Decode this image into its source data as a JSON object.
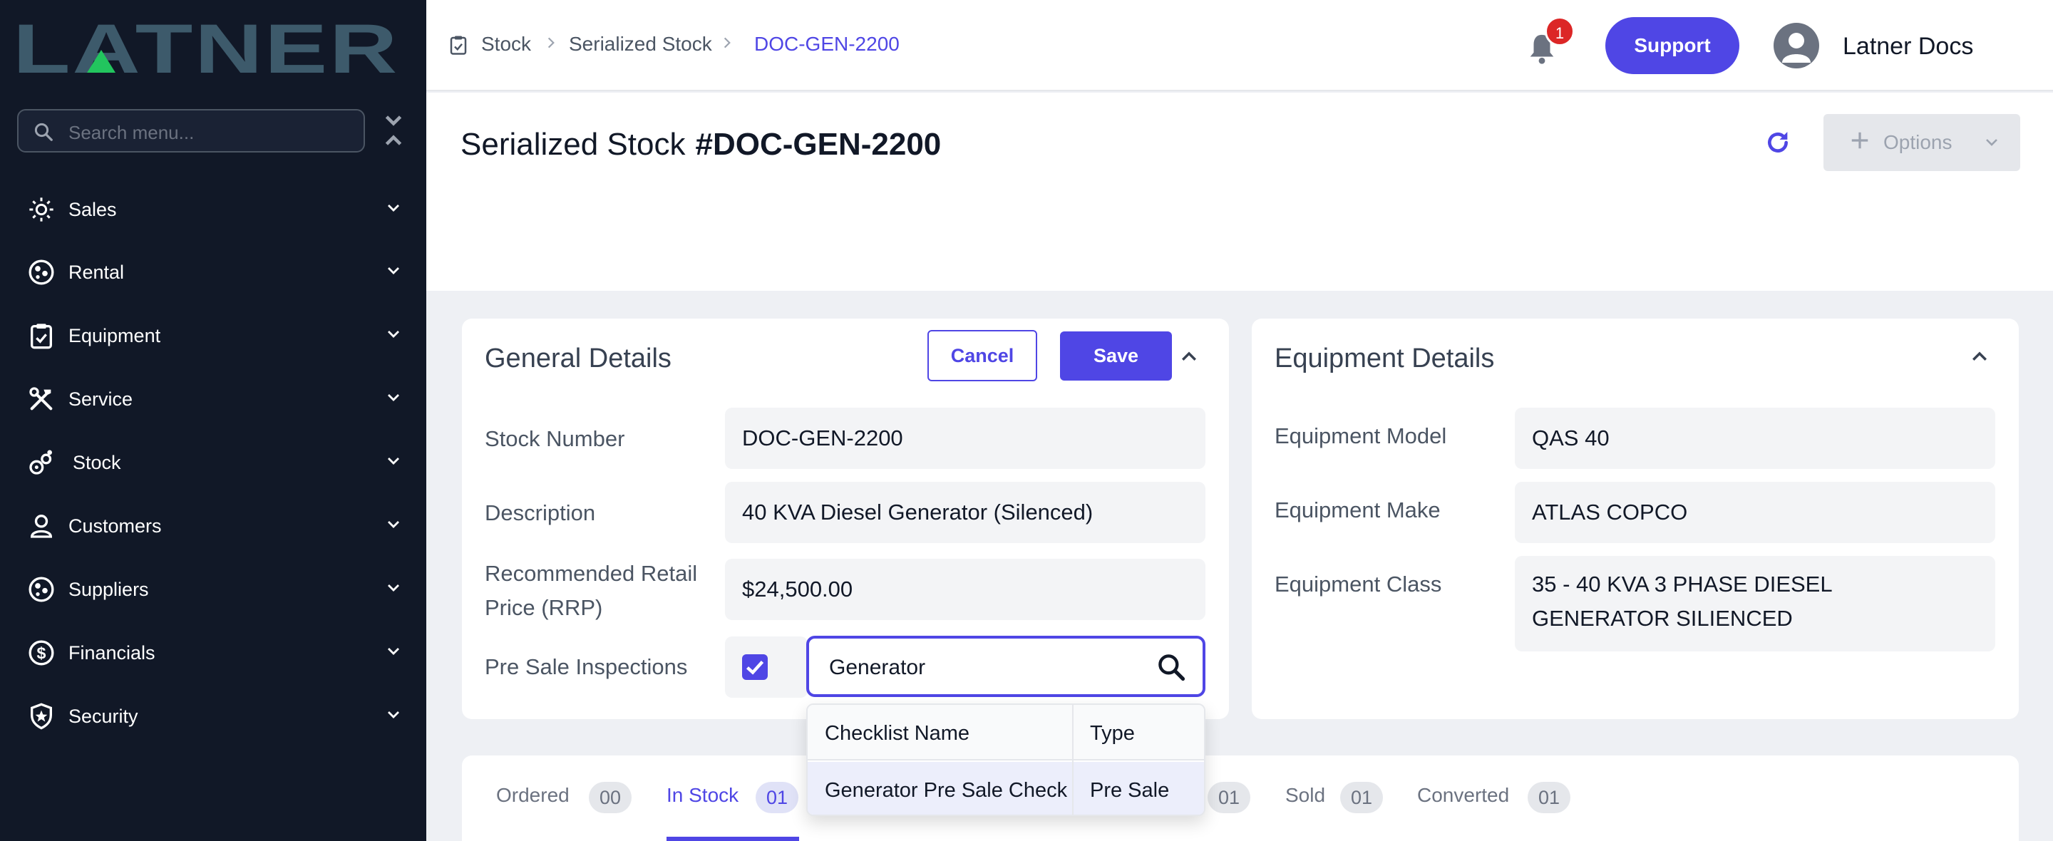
{
  "brand": {
    "logo_text": "LATNER",
    "accent": "#4f46e5",
    "sidebar_bg": "#111827"
  },
  "sidebar": {
    "search_placeholder": "Search menu...",
    "items": [
      {
        "label": "Sales",
        "icon": "sales-icon"
      },
      {
        "label": "Rental",
        "icon": "rental-icon"
      },
      {
        "label": "Equipment",
        "icon": "clipboard-icon"
      },
      {
        "label": "Service",
        "icon": "tools-icon"
      },
      {
        "label": "Stock",
        "icon": "stock-icon"
      },
      {
        "label": "Customers",
        "icon": "user-icon"
      },
      {
        "label": "Suppliers",
        "icon": "suppliers-icon"
      },
      {
        "label": "Financials",
        "icon": "dollar-icon"
      },
      {
        "label": "Security",
        "icon": "shield-icon"
      }
    ]
  },
  "header": {
    "breadcrumb": [
      "Stock",
      "Serialized Stock",
      "DOC-GEN-2200"
    ],
    "notification_count": "1",
    "support_label": "Support",
    "user_name": "Latner Docs"
  },
  "page": {
    "title": "Serialized Stock",
    "record_id": "#DOC-GEN-2200",
    "options_label": "Options"
  },
  "general_details": {
    "title": "General Details",
    "cancel_label": "Cancel",
    "save_label": "Save",
    "fields": {
      "stock_number": {
        "label": "Stock Number",
        "value": "DOC-GEN-2200"
      },
      "description": {
        "label": "Description",
        "value": "40 KVA Diesel Generator (Silenced)"
      },
      "rrp": {
        "label_line1": "Recommended Retail",
        "label_line2": "Price (RRP)",
        "value": "$24,500.00"
      },
      "pre_sale": {
        "label": "Pre Sale Inspections",
        "checked": true,
        "lookup_value": "Generator"
      }
    },
    "dropdown": {
      "headers": [
        "Checklist Name",
        "Type"
      ],
      "rows": [
        {
          "name": "Generator Pre Sale Check",
          "type": "Pre Sale"
        }
      ]
    }
  },
  "equipment_details": {
    "title": "Equipment Details",
    "fields": {
      "model": {
        "label": "Equipment Model",
        "value": "QAS 40"
      },
      "make": {
        "label": "Equipment Make",
        "value": "ATLAS COPCO"
      },
      "class": {
        "label": "Equipment Class",
        "value_line1": "35 - 40 KVA 3 PHASE DIESEL",
        "value_line2": "GENERATOR SILIENCED"
      }
    }
  },
  "tabs": [
    {
      "label": "Ordered",
      "count": "00",
      "active": false
    },
    {
      "label": "In Stock",
      "count": "01",
      "active": true
    },
    {
      "label": "",
      "count": "01",
      "active": false
    },
    {
      "label": "Sold",
      "count": "01",
      "active": false
    },
    {
      "label": "Converted",
      "count": "01",
      "active": false
    }
  ]
}
